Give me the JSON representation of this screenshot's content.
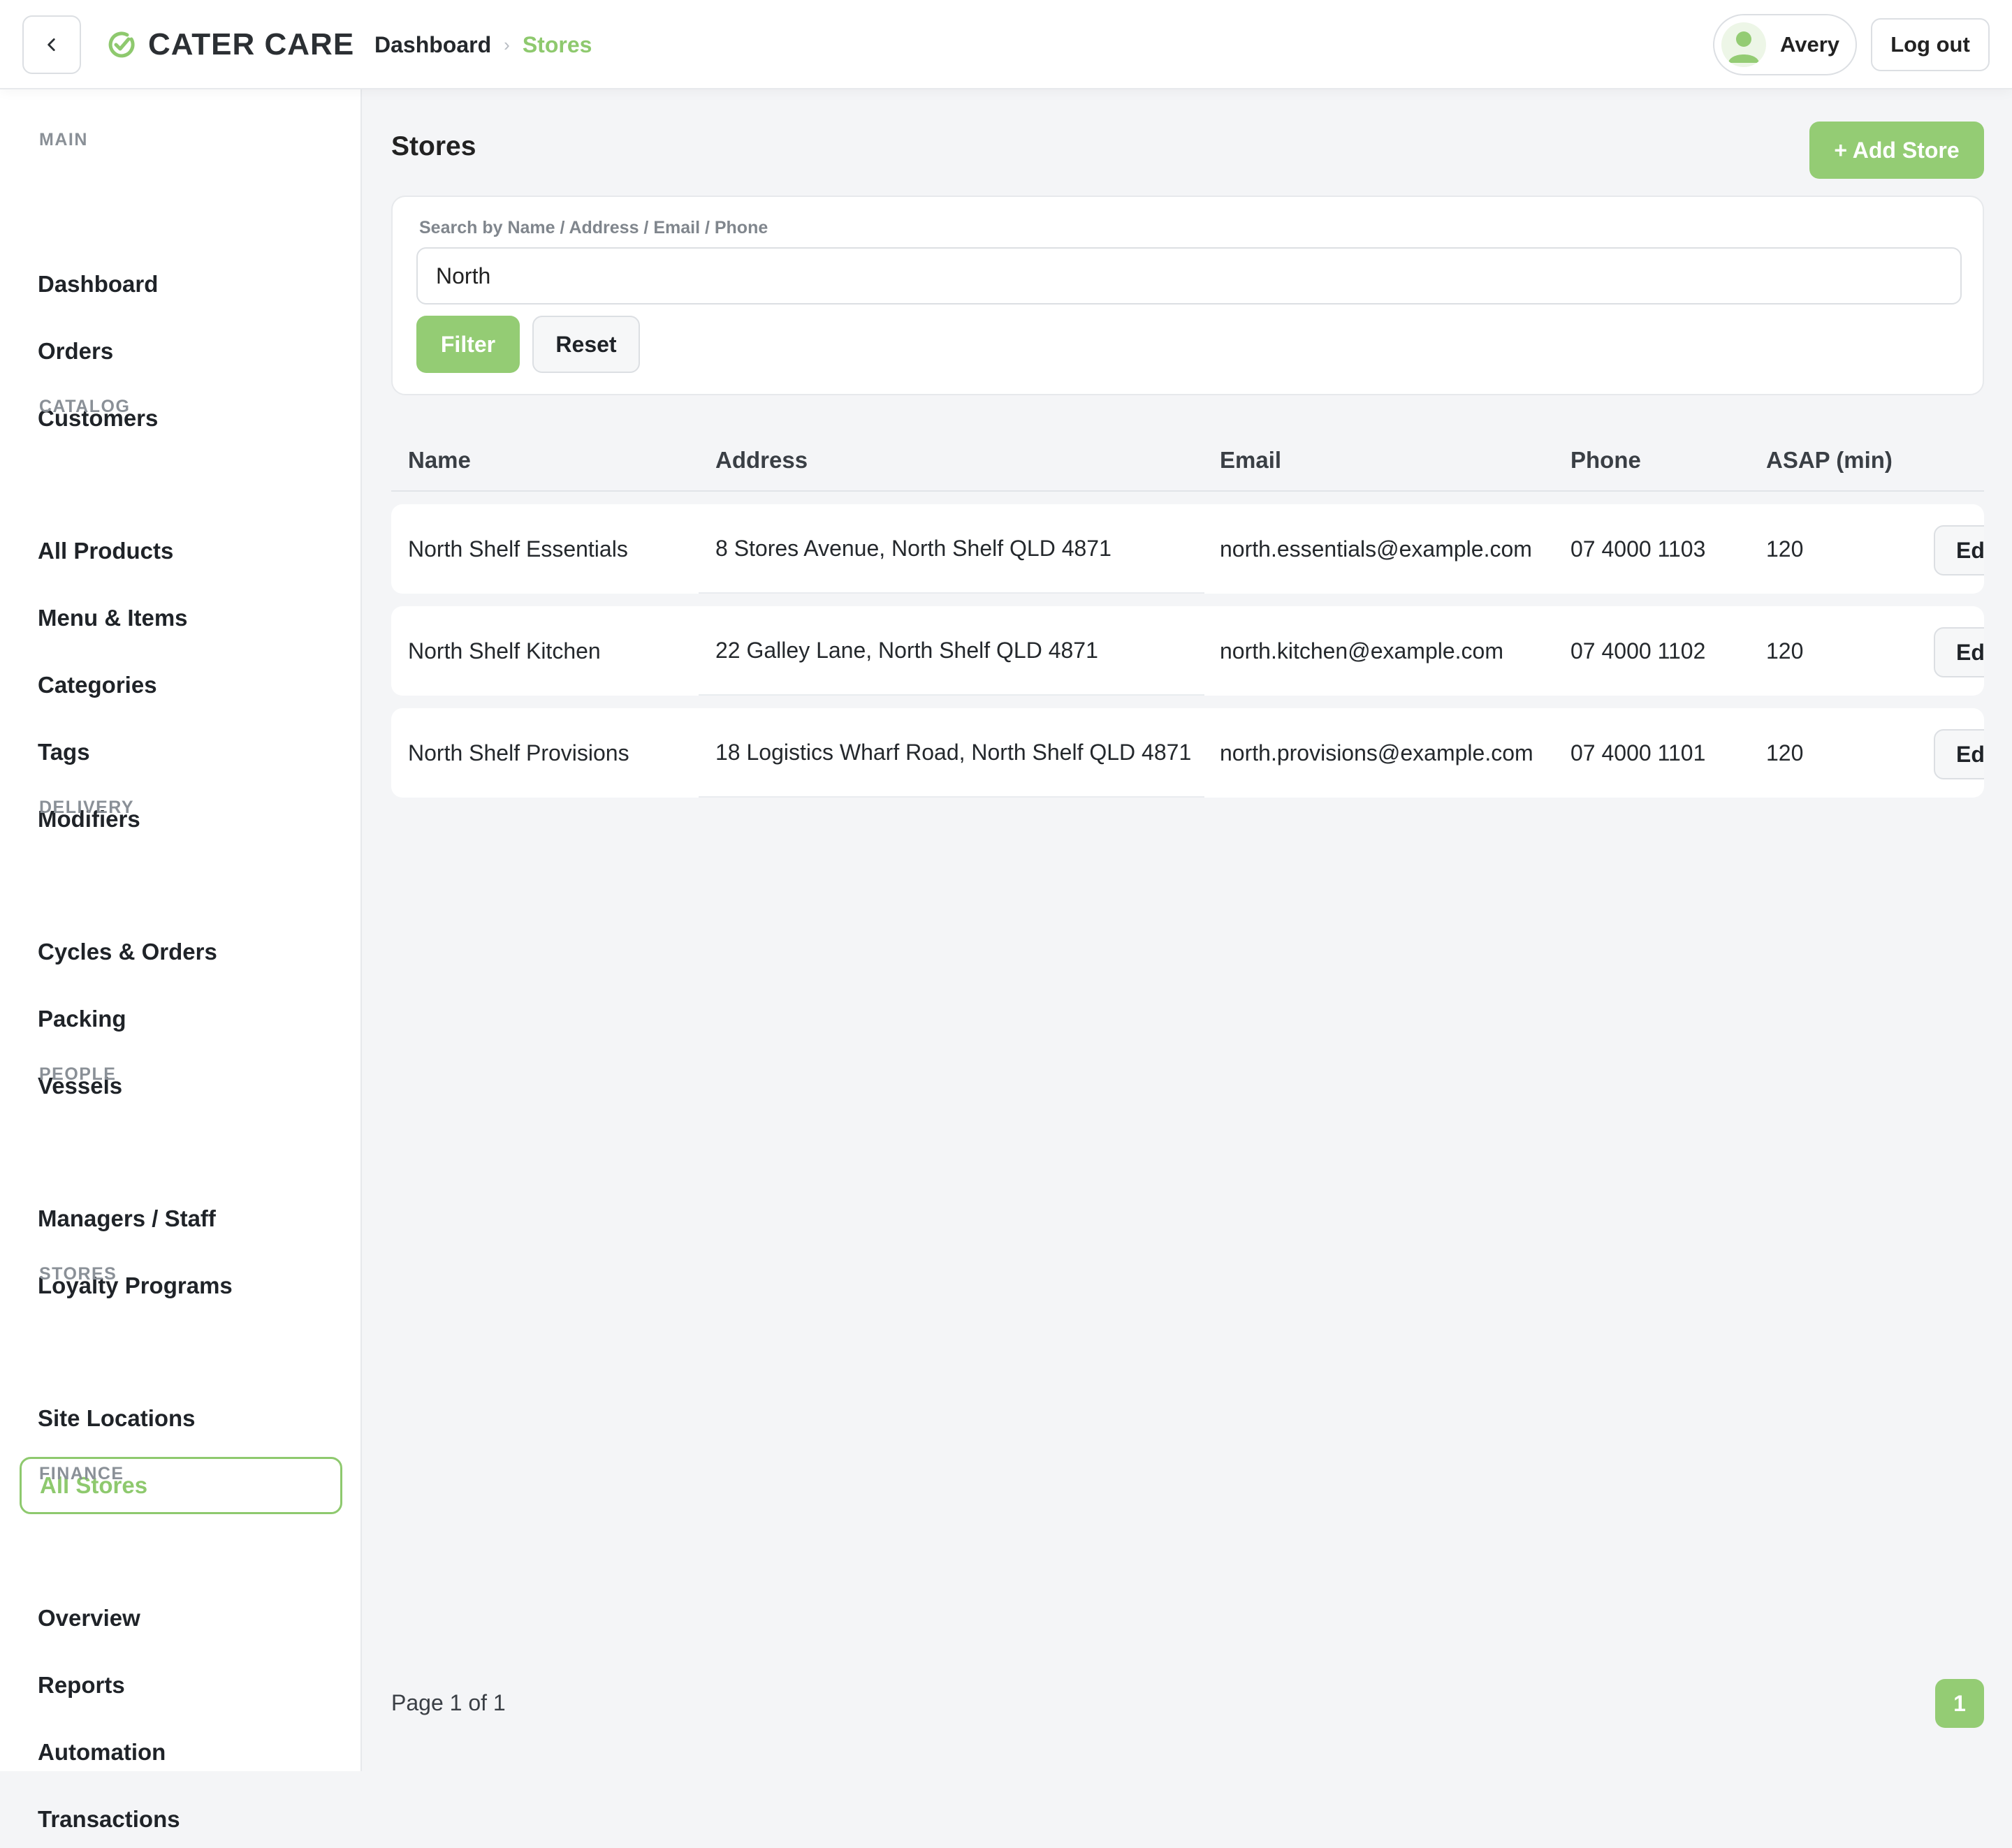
{
  "header": {
    "brand": "CATER CARE",
    "breadcrumb": {
      "home": "Dashboard",
      "separator": "›",
      "current": "Stores"
    },
    "user_name": "Avery",
    "logout_label": "Log out",
    "accent_color": "#8ec96e"
  },
  "sidebar": {
    "sections": [
      {
        "title": "MAIN",
        "items": [
          "Dashboard",
          "Orders",
          "Customers"
        ]
      },
      {
        "title": "CATALOG",
        "items": [
          "All Products",
          "Menu & Items",
          "Categories",
          "Tags",
          "Modifiers"
        ]
      },
      {
        "title": "DELIVERY",
        "items": [
          "Cycles & Orders",
          "Packing",
          "Vessels"
        ]
      },
      {
        "title": "PEOPLE",
        "items": [
          "Managers / Staff",
          "Loyalty Programs"
        ]
      },
      {
        "title": "STORES",
        "items": [
          "Site Locations",
          "All Stores"
        ]
      },
      {
        "title": "FINANCE",
        "items": [
          "Overview",
          "Reports",
          "Automation",
          "Transactions"
        ]
      }
    ],
    "active_item": "All Stores"
  },
  "main": {
    "title": "Stores",
    "add_button": "+ Add Store",
    "search": {
      "label": "Search by Name / Address / Email / Phone",
      "value": "North",
      "filter_label": "Filter",
      "reset_label": "Reset"
    },
    "table": {
      "columns": [
        "Name",
        "Address",
        "Email",
        "Phone",
        "ASAP (min)"
      ],
      "rows": [
        {
          "name": "North Shelf Essentials",
          "address": "8 Stores Avenue, North Shelf QLD 4871",
          "email": "north.essentials@example.com",
          "phone": "07 4000 1103",
          "asap": "120",
          "action": "Ed"
        },
        {
          "name": "North Shelf Kitchen",
          "address": "22 Galley Lane, North Shelf QLD 4871",
          "email": "north.kitchen@example.com",
          "phone": "07 4000 1102",
          "asap": "120",
          "action": "Ed"
        },
        {
          "name": "North Shelf Provisions",
          "address": "18 Logistics Wharf Road, North Shelf QLD 4871",
          "email": "north.provisions@example.com",
          "phone": "07 4000 1101",
          "asap": "120",
          "action": "Ed"
        }
      ]
    },
    "pagination": {
      "text": "Page 1 of 1",
      "current_page": "1"
    }
  }
}
